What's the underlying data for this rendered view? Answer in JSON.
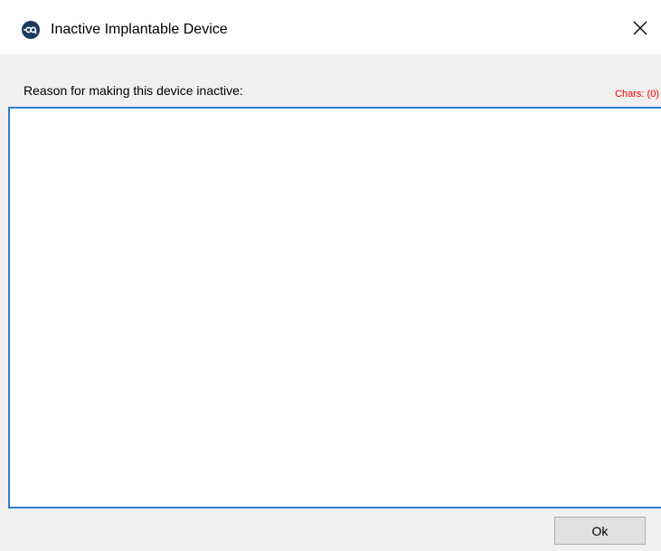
{
  "window": {
    "title": "Inactive Implantable Device",
    "app_icon": "op-logo-icon",
    "close_icon": "close-icon"
  },
  "form": {
    "reason_label": "Reason for making this device inactive:",
    "chars_counter": "Chars: (0)",
    "reason_value": "",
    "counter_color": "#ff0000",
    "accent_color": "#2f7fd1"
  },
  "buttons": {
    "ok_label": "Ok"
  }
}
